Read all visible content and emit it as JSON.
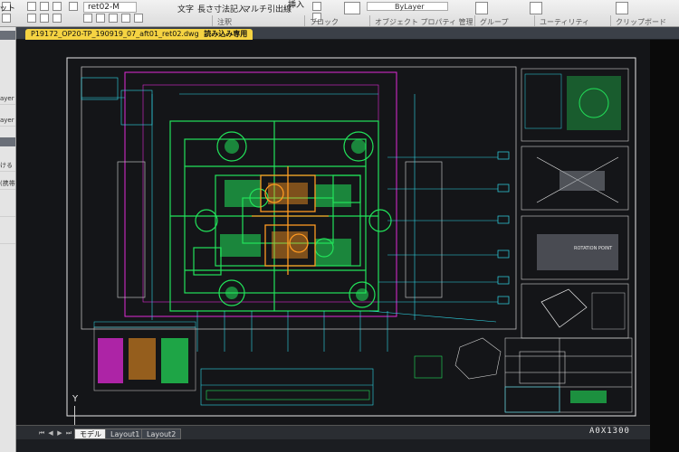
{
  "ribbon": {
    "items": [
      {
        "label": "レット",
        "name": "ribbon-palette-label"
      },
      {
        "label": "ret02-M",
        "name": "ribbon-style-select"
      },
      {
        "label": "文字",
        "name": "ribbon-text-button"
      },
      {
        "label": "長さ寸法記入",
        "name": "ribbon-linear-dim-button"
      },
      {
        "label": "マルチ引出線",
        "name": "ribbon-multileader-button"
      },
      {
        "label": "挿入",
        "name": "ribbon-insert-button"
      }
    ],
    "groups": [
      {
        "label": "注釈",
        "name": "group-annotation"
      },
      {
        "label": "ブロック",
        "name": "group-block"
      },
      {
        "label": "オブジェクト プロパティ 管理",
        "name": "group-properties"
      },
      {
        "label": "グループ",
        "name": "group-group"
      },
      {
        "label": "ユーティリティ",
        "name": "group-utilities"
      },
      {
        "label": "クリップボード",
        "name": "group-clipboard"
      }
    ],
    "layer_value": "ByLayer"
  },
  "left_panel": {
    "rows": [
      "ayer",
      "ayer",
      "ける",
      "(携帯号",
      "",
      ""
    ]
  },
  "document_tab": {
    "filename": "P19172_OP20-TP_190919_07_aft01_ret02.dwg",
    "mode": "読み込み専用"
  },
  "drawing": {
    "scale_label": "A0X1300",
    "ucs_label": "Y",
    "rotation_label": "ROTATION POINT"
  },
  "layout_tabs": [
    {
      "label": "モデル",
      "active": true
    },
    {
      "label": "Layout1",
      "active": false
    },
    {
      "label": "Layout2",
      "active": false
    }
  ],
  "colors": {
    "green": "#22e35a",
    "magenta": "#e02ad6",
    "orange": "#ff9a22",
    "cyan": "#2fd8e8",
    "white": "#e8e8e8",
    "canvas": "#141518",
    "tab_yellow": "#f5d342"
  }
}
